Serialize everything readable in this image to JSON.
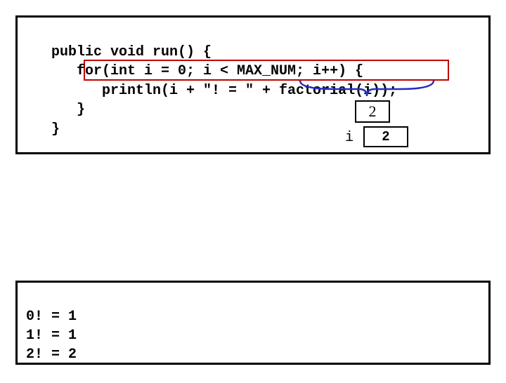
{
  "code": {
    "line1": "public void run() {",
    "line2": "   for(int i = 0; i < MAX_NUM; i++) {",
    "line3": "      println(i + \"! = \" + factorial(i));",
    "line4": "   }",
    "line5": "}"
  },
  "trace": {
    "factorial_result": "2",
    "var_i_label": "i",
    "var_i_value": "2"
  },
  "output": {
    "line1": "0! = 1",
    "line2": "1! = 1",
    "line3": "2! = 2"
  }
}
